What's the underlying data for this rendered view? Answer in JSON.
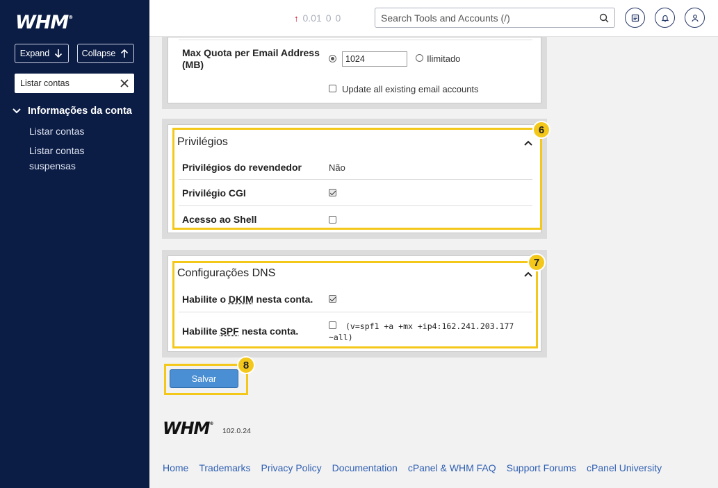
{
  "brand": {
    "logo": "WHM",
    "tm": "®"
  },
  "sidebar": {
    "expand_label": "Expand",
    "collapse_label": "Collapse",
    "search_value": "Listar contas",
    "category": "Informações da conta",
    "items": [
      {
        "label": "Listar contas"
      },
      {
        "label": "Listar contas suspensas"
      }
    ]
  },
  "topbar": {
    "load": [
      "0.01",
      "0",
      "0"
    ],
    "search_placeholder": "Search Tools and Accounts (/)"
  },
  "email_section": {
    "max_quota_label": "Max Quota per Email Address (MB)",
    "quota_value": "1024",
    "unlimited_label": "Ilimitado",
    "update_label": "Update all existing email accounts"
  },
  "privileges": {
    "title": "Privilégios",
    "badge": "6",
    "reseller_label": "Privilégios do revendedor",
    "reseller_value": "Não",
    "cgi_label": "Privilégio CGI",
    "shell_label": "Acesso ao Shell"
  },
  "dns": {
    "title": "Configurações DNS",
    "badge": "7",
    "dkim_prefix": "Habilite o ",
    "dkim_abbr": "DKIM",
    "dkim_suffix": " nesta conta.",
    "spf_prefix": "Habilite ",
    "spf_abbr": "SPF",
    "spf_suffix": " nesta conta.",
    "spf_record_line1": "(v=spf1 +a +mx +ip4:162.241.203.177",
    "spf_record_line2": "~all)"
  },
  "save": {
    "label": "Salvar",
    "badge": "8"
  },
  "footer": {
    "logo": "WHM",
    "tm": "®",
    "version": "102.0.24",
    "links": [
      "Home",
      "Trademarks",
      "Privacy Policy",
      "Documentation",
      "cPanel & WHM FAQ",
      "Support Forums",
      "cPanel University"
    ]
  },
  "colors": {
    "sidebar": "#0b1c45",
    "highlight": "#f4c81a",
    "primary_button": "#4a8fd3",
    "link": "#2f5fb2"
  }
}
